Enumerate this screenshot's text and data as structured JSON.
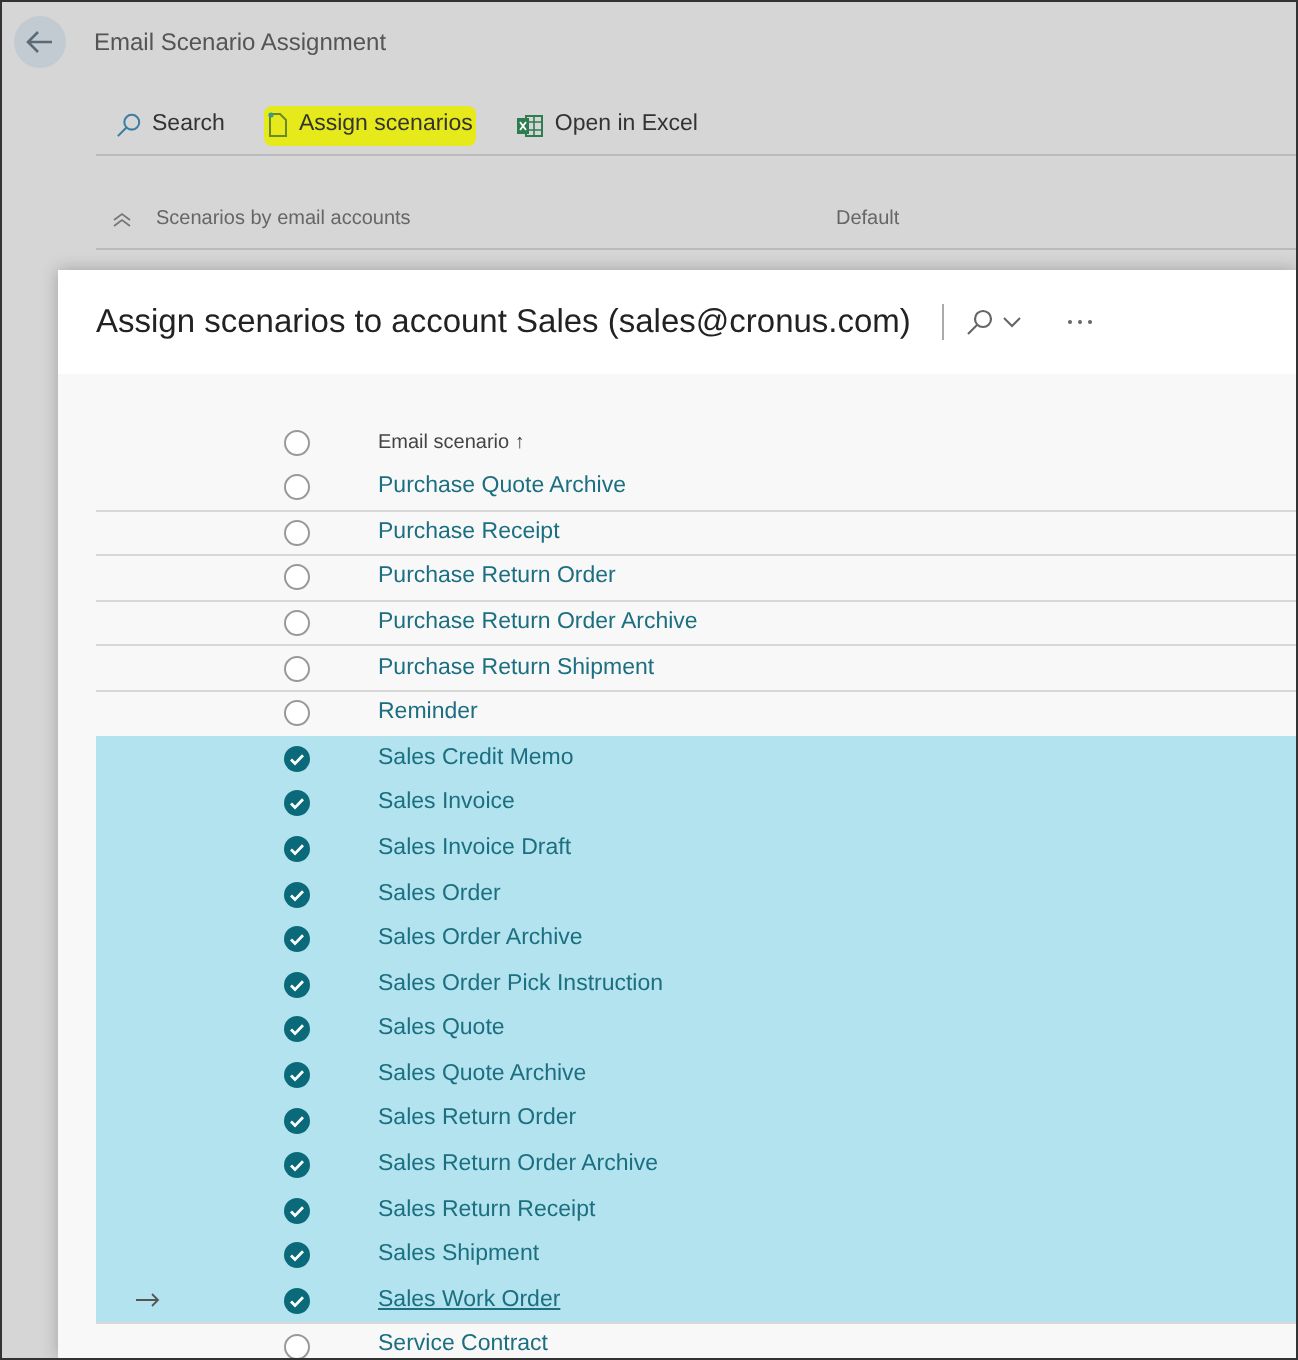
{
  "page": {
    "title": "Email Scenario Assignment"
  },
  "toolbar": [
    {
      "label": "Search",
      "kind": "search",
      "highlighted": false
    },
    {
      "label": "Assign scenarios",
      "kind": "assign",
      "highlighted": true
    },
    {
      "label": "Open in Excel",
      "kind": "excel",
      "highlighted": false
    }
  ],
  "list_header": {
    "column_1": "Scenarios by email accounts",
    "column_2": "Default"
  },
  "dialog": {
    "title": "Assign scenarios to account Sales (sales@cronus.com)",
    "column": "Email scenario",
    "sort_mark": "↑",
    "select_all_checked": false,
    "rows": [
      {
        "name": "Purchase Quote Archive",
        "selected": false,
        "current": false
      },
      {
        "name": "Purchase Receipt",
        "selected": false,
        "current": false
      },
      {
        "name": "Purchase Return Order",
        "selected": false,
        "current": false
      },
      {
        "name": "Purchase Return Order Archive",
        "selected": false,
        "current": false
      },
      {
        "name": "Purchase Return Shipment",
        "selected": false,
        "current": false
      },
      {
        "name": "Reminder",
        "selected": false,
        "current": false
      },
      {
        "name": "Sales Credit Memo",
        "selected": true,
        "current": false
      },
      {
        "name": "Sales Invoice",
        "selected": true,
        "current": false
      },
      {
        "name": "Sales Invoice Draft",
        "selected": true,
        "current": false
      },
      {
        "name": "Sales Order",
        "selected": true,
        "current": false
      },
      {
        "name": "Sales Order Archive",
        "selected": true,
        "current": false
      },
      {
        "name": "Sales Order Pick Instruction",
        "selected": true,
        "current": false
      },
      {
        "name": "Sales Quote",
        "selected": true,
        "current": false
      },
      {
        "name": "Sales Quote Archive",
        "selected": true,
        "current": false
      },
      {
        "name": "Sales Return Order",
        "selected": true,
        "current": false
      },
      {
        "name": "Sales Return Order Archive",
        "selected": true,
        "current": false
      },
      {
        "name": "Sales Return Receipt",
        "selected": true,
        "current": false
      },
      {
        "name": "Sales Shipment",
        "selected": true,
        "current": false
      },
      {
        "name": "Sales Work Order",
        "selected": true,
        "current": true
      },
      {
        "name": "Service Contract",
        "selected": false,
        "current": false
      }
    ]
  }
}
